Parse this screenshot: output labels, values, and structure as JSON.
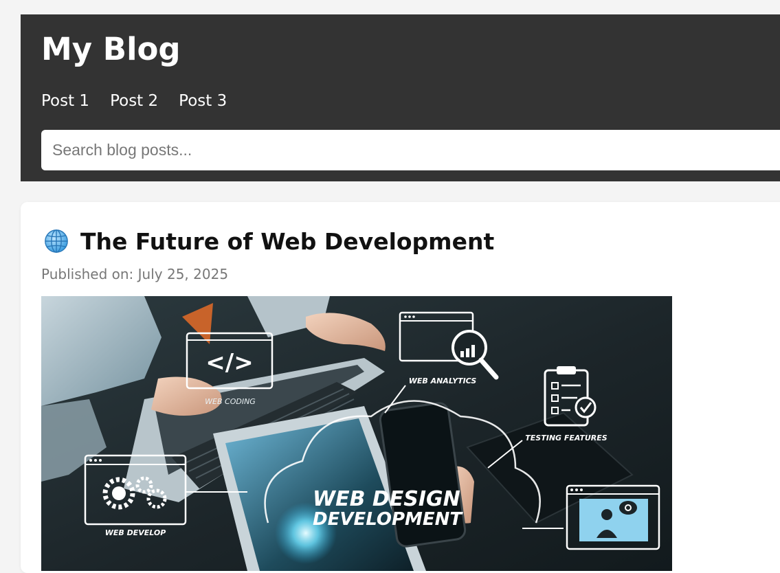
{
  "header": {
    "site_title": "My Blog",
    "nav": [
      "Post 1",
      "Post 2",
      "Post 3"
    ],
    "search_placeholder": "Search blog posts..."
  },
  "post": {
    "icon": "globe-icon",
    "title": "The Future of Web Development",
    "date_text": "Published on: July 25, 2025",
    "image": {
      "labels": {
        "web_analytics": "WEB ANALYTICS",
        "web_coding": "WEB CODING",
        "testing_features": "TESTING FEATURES",
        "web_develop": "WEB DEVELOP",
        "heading_line1": "WEB DESIGN",
        "heading_line2": "DEVELOPMENT",
        "code_symbol": "</>"
      }
    }
  },
  "colors": {
    "header_bg": "#333333",
    "page_bg": "#f4f4f4",
    "card_bg": "#ffffff",
    "date_text": "#777777"
  }
}
